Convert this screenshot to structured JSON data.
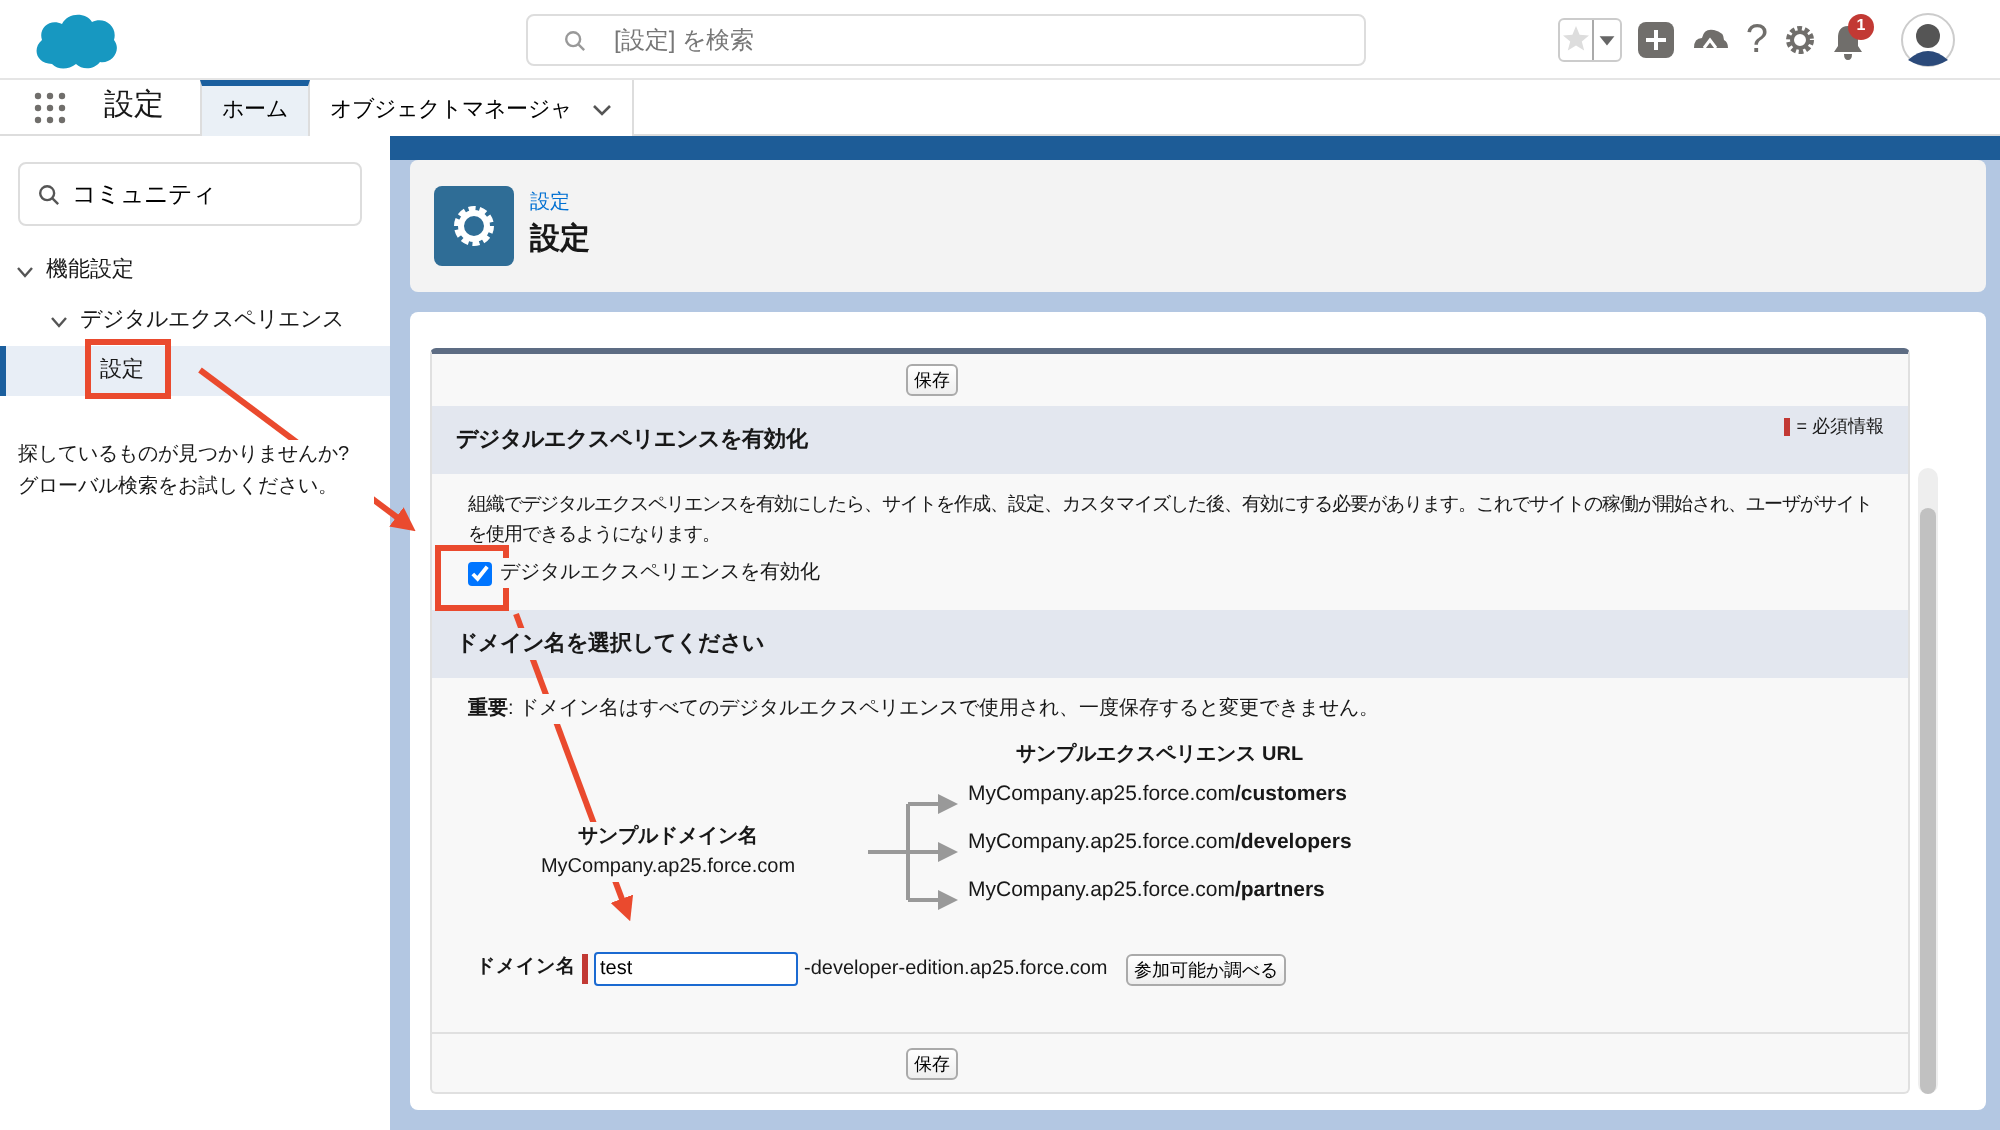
{
  "global_search": {
    "placeholder": "[設定] を検索"
  },
  "notifications": {
    "count": "1"
  },
  "help_icon": "?",
  "app_nav": {
    "app_name": "設定",
    "tabs": [
      {
        "label": "ホーム",
        "selected": true,
        "kind": "plain"
      },
      {
        "label": "オブジェクトマネージャ",
        "selected": false,
        "kind": "dropdown"
      }
    ]
  },
  "sidebar": {
    "search": {
      "value": "コミュニティ"
    },
    "tree": [
      {
        "label": "機能設定",
        "expanded": true,
        "selected": false,
        "children": [
          {
            "label": "デジタルエクスペリエンス",
            "expanded": true,
            "selected": false,
            "children": [
              {
                "label": "設定",
                "selected": true
              }
            ]
          }
        ]
      }
    ],
    "hint": "探しているものが見つかりませんか? グローバル検索をお試しください。"
  },
  "page_header": {
    "breadcrumb": "設定",
    "title": "設定"
  },
  "form": {
    "top_button": "保存",
    "bottom_button": "保存",
    "section_1": {
      "title": "デジタルエクスペリエンスを有効化",
      "required_legend": "= 必須情報",
      "description": "組織でデジタルエクスペリエンスを有効にしたら、サイトを作成、設定、カスタマイズした後、有効にする必要があります。これでサイトの稼働が開始され、ユーザがサイトを使用できるようになります。",
      "checkbox": {
        "label": "デジタルエクスペリエンスを有効化",
        "checked": true
      }
    },
    "section_2": {
      "title": "ドメイン名を選択してください",
      "note": "**重要**: ドメイン名はすべてのデジタルエクスペリエンスで使用され、一度保存すると変更できません。",
      "diagram": {
        "domain_label": "サンプルドメイン名",
        "domain": "MyCompany.ap25.force.com",
        "urls_label": "サンプルエクスペリエンス URL",
        "urls": [
          "MyCompany.ap25.force.com**/customers**",
          "MyCompany.ap25.force.com**/developers**",
          "MyCompany.ap25.force.com**/partners**"
        ]
      },
      "domain_field": {
        "label": "ドメイン名",
        "value": "test",
        "suffix": "-developer-edition.ap25.force.com",
        "check_button": "参加可能か調べる"
      }
    }
  }
}
